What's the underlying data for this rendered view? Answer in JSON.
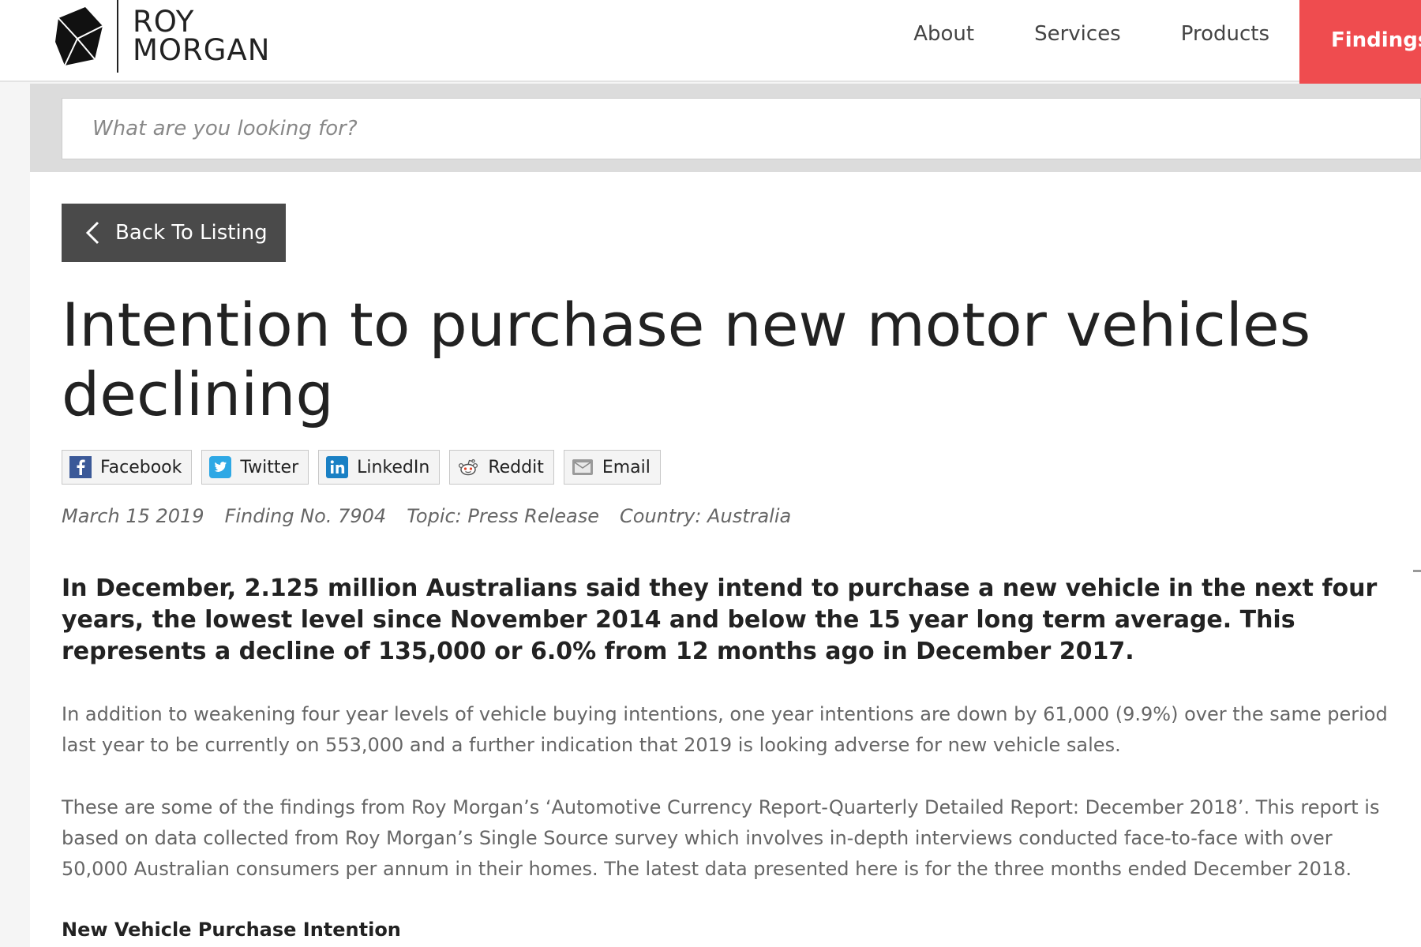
{
  "header": {
    "logo_line1": "ROY",
    "logo_line2": "MORGAN",
    "nav": [
      {
        "label": "About"
      },
      {
        "label": "Services"
      },
      {
        "label": "Products"
      },
      {
        "label": "Findings",
        "active": true
      }
    ],
    "accent_color": "#ef4c4f"
  },
  "search": {
    "placeholder": "What are you looking for?"
  },
  "article": {
    "back_label": "Back To Listing",
    "title": "Intention to purchase new motor vehicles declining",
    "share": [
      {
        "label": "Facebook",
        "icon": "facebook-icon"
      },
      {
        "label": "Twitter",
        "icon": "twitter-icon"
      },
      {
        "label": "LinkedIn",
        "icon": "linkedin-icon"
      },
      {
        "label": "Reddit",
        "icon": "reddit-icon"
      },
      {
        "label": "Email",
        "icon": "email-icon"
      }
    ],
    "date": "March 15 2019",
    "finding_no": "Finding No. 7904",
    "topic": "Topic: Press Release",
    "country": "Country: Australia",
    "lead": "In December, 2.125 million Australians said they intend to purchase a new vehicle in the next four years, the lowest level since November 2014 and below the 15 year long term average. This represents a decline of 135,000 or 6.0% from 12 months ago in December 2017.",
    "paragraphs": [
      "In addition to weakening four year levels of vehicle buying intentions, one year intentions are down by 61,000 (9.9%) over the same period last year to be currently on 553,000 and a further indication that 2019 is looking adverse for new vehicle sales.",
      "These are some of the findings from Roy Morgan’s ‘Automotive Currency Report-Quarterly Detailed Report: December 2018’. This report is based on data collected from Roy Morgan’s Single Source survey which involves in-depth interviews conducted face-to-face with over 50,000 Australian consumers per annum in their homes. The latest data presented here is for the three months ended December 2018."
    ],
    "subheading": "New Vehicle Purchase Intention"
  }
}
